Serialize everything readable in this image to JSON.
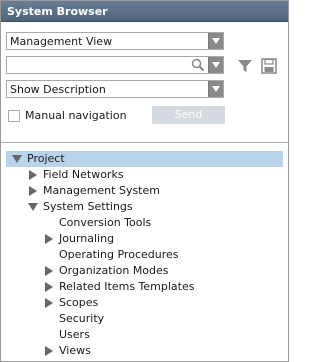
{
  "window": {
    "title": "System Browser"
  },
  "view_select": {
    "value": "Management View"
  },
  "search": {
    "value": "",
    "placeholder": ""
  },
  "description_select": {
    "value": "Show Description"
  },
  "manual_navigation": {
    "label": "Manual navigation",
    "checked": false
  },
  "send_button": {
    "label": "Send",
    "enabled": false
  },
  "icons": {
    "filter": "filter-icon",
    "save": "save-icon",
    "search": "search-icon"
  },
  "tree": {
    "root": {
      "label": "Project",
      "expanded": true,
      "selected": true
    },
    "items": [
      {
        "label": "Field Networks",
        "expander": "collapsed"
      },
      {
        "label": "Management System",
        "expander": "collapsed"
      },
      {
        "label": "System Settings",
        "expander": "expanded"
      },
      {
        "label": "Conversion Tools",
        "expander": "none"
      },
      {
        "label": "Journaling",
        "expander": "collapsed"
      },
      {
        "label": "Operating Procedures",
        "expander": "none"
      },
      {
        "label": "Organization Modes",
        "expander": "collapsed"
      },
      {
        "label": "Related Items Templates",
        "expander": "collapsed"
      },
      {
        "label": "Scopes",
        "expander": "collapsed"
      },
      {
        "label": "Security",
        "expander": "none"
      },
      {
        "label": "Users",
        "expander": "none"
      },
      {
        "label": "Views",
        "expander": "collapsed"
      }
    ]
  },
  "colors": {
    "titlebar": "#5a6e84",
    "selection": "#b9d3ea",
    "dropdown_button": "#8a8a8a",
    "send_disabled": "#d4dae0"
  }
}
